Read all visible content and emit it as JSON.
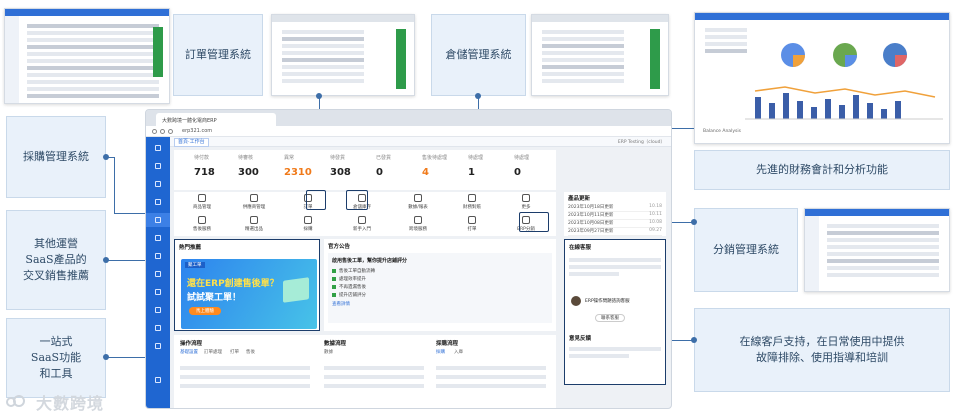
{
  "callouts": {
    "order_mgmt": "訂單管理系統",
    "warehouse_mgmt": "倉儲管理系統",
    "purchase_mgmt": "採購管理系統",
    "saas_cross_sell": [
      "其他運營",
      "SaaS產品的",
      "交叉銷售推薦"
    ],
    "one_stop": [
      "一站式",
      "SaaS功能",
      "和工具"
    ],
    "finance": "先進的財務會計和分析功能",
    "distribution": "分銷管理系統",
    "online_support": [
      "在線客戶支持，在日常使用中提供",
      "故障排除、使用指導和培訓"
    ]
  },
  "logo": {
    "text": "大數跨境"
  },
  "main_window": {
    "tab_title": "大數跨境一體化電商ERP",
    "url": "erp321.com",
    "app_tab": "首頁·工作台",
    "top_right": "ERP Testing（cloud）",
    "stats": [
      {
        "label": "待付款",
        "value": "718",
        "color": "#222222"
      },
      {
        "label": "待審核",
        "value": "300",
        "color": "#222222"
      },
      {
        "label": "異常",
        "value": "2310",
        "color": "#f07a1a"
      },
      {
        "label": "待發貨",
        "value": "308",
        "color": "#222222"
      },
      {
        "label": "已發貨",
        "value": "0",
        "color": "#222222"
      },
      {
        "label": "售後待處理",
        "value": "4",
        "color": "#f07a1a"
      },
      {
        "label": "待處理",
        "value": "1",
        "color": "#222222"
      },
      {
        "label": "待處理",
        "value": "0",
        "color": "#222222"
      }
    ],
    "icons_row1": [
      "商品管理",
      "供應商管理",
      "訂單",
      "倉儲庫存",
      "數據/報表",
      "財務對賬",
      "更多"
    ],
    "icons_row2": [
      "售後服務",
      "精選出品",
      "採購",
      "新手入門",
      "跨境服務",
      "打單",
      "ERP分銷"
    ],
    "news": {
      "title": "產品更新",
      "items": [
        {
          "text": "2023年10月18日更新",
          "date": "10.18"
        },
        {
          "text": "2023年10月11日更新",
          "date": "10.11"
        },
        {
          "text": "2023年10月08日更新",
          "date": "10.08"
        },
        {
          "text": "2023年09月27日更新",
          "date": "09.27"
        },
        {
          "text": "2023年09月20日更新",
          "date": "09.20"
        }
      ]
    },
    "hot": {
      "title": "熱門推薦",
      "banner_tag": "聚工單",
      "banner_line1": "還在ERP創建售後單？",
      "banner_line2": "試試聚工單！",
      "banner_button": "馬上體驗"
    },
    "notice": {
      "title": "官方公告",
      "headline": "啟用售後工單，幫你提升店鋪評分",
      "items": [
        "售後工單自動流轉",
        "處理效率提升",
        "不再遺漏售後",
        "提升店鋪評分",
        "查看詳情"
      ]
    },
    "support": {
      "title": "在線客服",
      "agent": "ERP操作問題諮詢客服",
      "button": "聯系客服",
      "footer_title": "意見反饋"
    },
    "bottom": {
      "col1": {
        "title": "操作流程",
        "tabs": [
          "基礎設置",
          "訂單處理",
          "打單",
          "售後"
        ]
      },
      "col2": {
        "title": "數據流程",
        "tabs": [
          "數據"
        ]
      },
      "col3": {
        "title": "採購流程",
        "tabs": [
          "採購",
          "入庫"
        ]
      }
    }
  },
  "thumb_finance": {
    "label": "Balance Analysis"
  }
}
